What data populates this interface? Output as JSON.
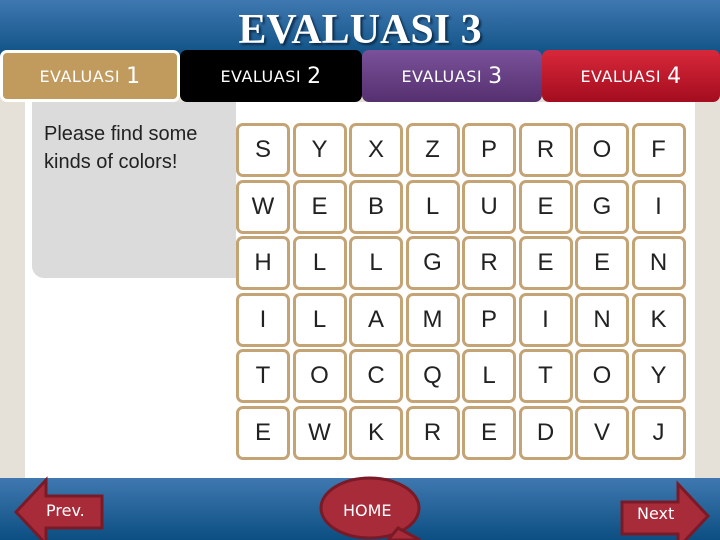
{
  "header": {
    "title": "EVALUASI 3"
  },
  "tabs": [
    {
      "label": "EVALUASI",
      "num": "1",
      "color": "#c19a5e"
    },
    {
      "label": "EVALUASI",
      "num": "2",
      "color": "#000000"
    },
    {
      "label": "EVALUASI",
      "num": "3",
      "color": "#6a4288"
    },
    {
      "label": "EVALUASI",
      "num": "4",
      "color": "#c0152a"
    }
  ],
  "instruction": "Please find some kinds of colors!",
  "grid": [
    [
      "S",
      "Y",
      "X",
      "Z",
      "P",
      "R",
      "O",
      "F"
    ],
    [
      "W",
      "E",
      "B",
      "L",
      "U",
      "E",
      "G",
      "I"
    ],
    [
      "H",
      "L",
      "L",
      "G",
      "R",
      "E",
      "E",
      "N"
    ],
    [
      "I",
      "L",
      "A",
      "M",
      "P",
      "I",
      "N",
      "K"
    ],
    [
      "T",
      "O",
      "C",
      "Q",
      "L",
      "T",
      "O",
      "Y"
    ],
    [
      "E",
      "W",
      "K",
      "R",
      "E",
      "D",
      "V",
      "J"
    ]
  ],
  "footer": {
    "prev": "Prev.",
    "home": "HOME",
    "next": "Next"
  }
}
